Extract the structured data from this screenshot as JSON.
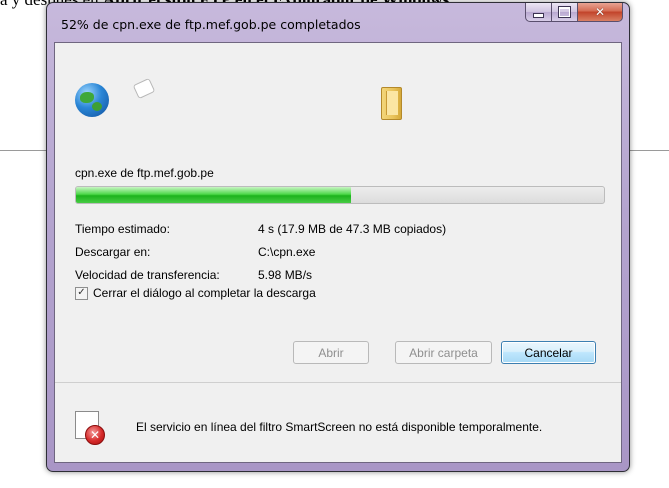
{
  "background": {
    "line_prefix": "a y después en ",
    "line_bold": "Abrir el sitio FTP en el Explorador de Windows."
  },
  "window": {
    "title": "52% de cpn.exe de ftp.mef.gob.pe completados",
    "buttons": {
      "minimize": "minimize",
      "maximize": "maximize",
      "close_glyph": "✕"
    }
  },
  "download": {
    "file_label": "cpn.exe de ftp.mef.gob.pe",
    "progress_percent": 52,
    "rows": [
      {
        "label": "Tiempo estimado:",
        "value": "4 s (17.9 MB de 47.3 MB copiados)"
      },
      {
        "label": "Descargar en:",
        "value": "C:\\cpn.exe"
      },
      {
        "label": "Velocidad de transferencia:",
        "value": "5.98 MB/s"
      }
    ],
    "close_on_complete": {
      "label": "Cerrar el diálogo al completar la descarga",
      "checked": true,
      "check_glyph": "✓"
    }
  },
  "actions": {
    "open": "Abrir",
    "open_folder": "Abrir carpeta",
    "cancel": "Cancelar"
  },
  "smartscreen": {
    "message": "El servicio en línea del filtro SmartScreen no está disponible temporalmente.",
    "icon_glyph": "✕"
  },
  "icons": {
    "globe": "globe-icon",
    "paper": "document-flying-icon",
    "folder": "folder-icon",
    "smartscreen": "smartscreen-error-icon"
  },
  "colors": {
    "progress": "#1db31c",
    "title_frame": "#b4a4cf",
    "primary_border": "#3c7fb1"
  }
}
